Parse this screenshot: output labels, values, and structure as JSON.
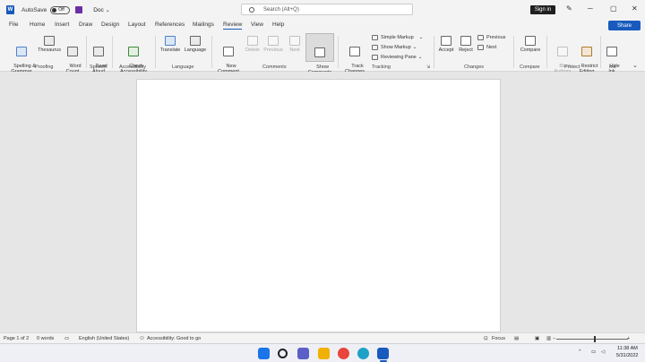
{
  "titlebar": {
    "autosave_label": "AutoSave",
    "autosave_state": "Off",
    "doc_name": "Doc",
    "search_placeholder": "Search (Alt+Q)",
    "signin_label": "Sign in",
    "logo_letter": "W"
  },
  "tabs": [
    "File",
    "Home",
    "Insert",
    "Draw",
    "Design",
    "Layout",
    "References",
    "Mailings",
    "Review",
    "View",
    "Help"
  ],
  "active_tab": "Review",
  "share_label": "Share",
  "ribbon": {
    "proofing": {
      "group_label": "Proofing",
      "spelling": "Spelling &\nGrammar",
      "thesaurus": "Thesaurus",
      "word_count": "Word\nCount"
    },
    "speech": {
      "group_label": "Speech",
      "read_aloud": "Read\nAloud"
    },
    "accessibility": {
      "group_label": "Accessibility",
      "check": "Check\nAccessibility"
    },
    "language": {
      "group_label": "Language",
      "translate": "Translate",
      "language": "Language"
    },
    "comments": {
      "group_label": "Comments",
      "new_comment": "New\nComment",
      "delete": "Delete",
      "previous": "Previous",
      "next": "Next",
      "show_comments": "Show\nComments"
    },
    "tracking": {
      "group_label": "Tracking",
      "track_changes": "Track\nChanges",
      "simple_markup": "Simple Markup",
      "show_markup": "Show Markup",
      "reviewing_pane": "Reviewing Pane"
    },
    "changes": {
      "group_label": "Changes",
      "accept": "Accept",
      "reject": "Reject",
      "previous": "Previous",
      "next": "Next"
    },
    "compare": {
      "group_label": "Compare",
      "compare": "Compare"
    },
    "protect": {
      "group_label": "Protect",
      "block_authors": "Block\nAuthors",
      "restrict_editing": "Restrict\nEditing"
    },
    "ink": {
      "group_label": "Ink",
      "hide_ink": "Hide\nInk"
    }
  },
  "statusbar": {
    "page": "Page 1 of 2",
    "words": "0 words",
    "language": "English (United States)",
    "accessibility": "Accessibility: Good to go",
    "focus": "Focus"
  },
  "taskbar": {
    "time": "11:38 AM",
    "date": "5/31/2022"
  },
  "colors": {
    "word_blue": "#185abd",
    "chrome_bg": "#f3f3f3",
    "canvas_bg": "#e6e6e6"
  }
}
